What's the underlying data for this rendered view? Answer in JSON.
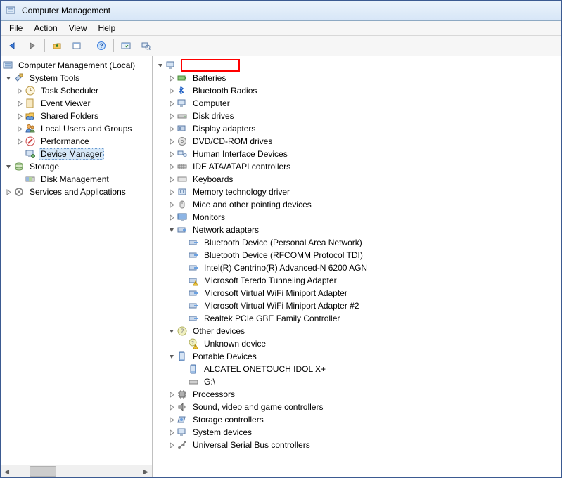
{
  "title": "Computer Management",
  "menus": {
    "file": "File",
    "action": "Action",
    "view": "View",
    "help": "Help"
  },
  "left": {
    "root": "Computer Management (Local)",
    "systools": "System Tools",
    "systools_children": [
      "Task Scheduler",
      "Event Viewer",
      "Shared Folders",
      "Local Users and Groups",
      "Performance",
      "Device Manager"
    ],
    "storage": "Storage",
    "storage_children": [
      "Disk Management"
    ],
    "services": "Services and Applications"
  },
  "right": {
    "categories": [
      "Batteries",
      "Bluetooth Radios",
      "Computer",
      "Disk drives",
      "Display adapters",
      "DVD/CD-ROM drives",
      "Human Interface Devices",
      "IDE ATA/ATAPI controllers",
      "Keyboards",
      "Memory technology driver",
      "Mice and other pointing devices",
      "Monitors"
    ],
    "network": "Network adapters",
    "network_children": [
      "Bluetooth Device (Personal Area Network)",
      "Bluetooth Device (RFCOMM Protocol TDI)",
      "Intel(R) Centrino(R) Advanced-N 6200 AGN",
      "Microsoft Teredo Tunneling Adapter",
      "Microsoft Virtual WiFi Miniport Adapter",
      "Microsoft Virtual WiFi Miniport Adapter #2",
      "Realtek PCIe GBE Family Controller"
    ],
    "other": "Other devices",
    "other_children": [
      "Unknown device"
    ],
    "portable": "Portable Devices",
    "portable_children": [
      "ALCATEL ONETOUCH IDOL X+",
      "G:\\"
    ],
    "tail": [
      "Processors",
      "Sound, video and game controllers",
      "Storage controllers",
      "System devices",
      "Universal Serial Bus controllers"
    ]
  }
}
